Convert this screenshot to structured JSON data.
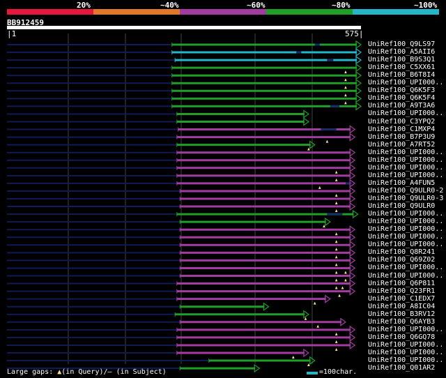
{
  "legend": [
    {
      "label": "20%",
      "color": "#e5183b"
    },
    {
      "label": "~40%",
      "color": "#e2782a"
    },
    {
      "label": "~60%",
      "color": "#a33ca1"
    },
    {
      "label": "~80%",
      "color": "#1f9f27"
    },
    {
      "label": "~100%",
      "color": "#26b6c9"
    }
  ],
  "query": {
    "id": "BB912459",
    "start": "1",
    "end": "575"
  },
  "footer": {
    "large_gaps": "Large gaps: ",
    "in_query": "(in Query)/",
    "dash": "—",
    "in_subject": " (in Subject)",
    "scale_label": "=100char."
  },
  "hits": [
    {
      "id": "UniRef100_Q9LS97",
      "color": "#1f9f27",
      "s": 268,
      "e": 575,
      "gaps": [
        [
          500,
          508
        ]
      ],
      "tri": []
    },
    {
      "id": "UniRef100_A5AII6",
      "color": "#26b6c9",
      "s": 268,
      "e": 575,
      "gaps": [
        [
          470,
          478
        ]
      ],
      "tri": []
    },
    {
      "id": "UniRef100_B9S3Q1",
      "color": "#26b6c9",
      "s": 273,
      "e": 575,
      "gaps": [
        [
          520,
          530
        ]
      ],
      "tri": []
    },
    {
      "id": "UniRef100_C5XX61",
      "color": "#1f9f27",
      "s": 268,
      "e": 575,
      "gaps": [],
      "tri": [
        550
      ]
    },
    {
      "id": "UniRef100_B6T8I4",
      "color": "#1f9f27",
      "s": 268,
      "e": 575,
      "gaps": [],
      "tri": [
        550
      ]
    },
    {
      "id": "UniRef100_UPI000..",
      "color": "#1f9f27",
      "s": 268,
      "e": 575,
      "gaps": [],
      "tri": [
        550
      ]
    },
    {
      "id": "UniRef100_Q6K5F3",
      "color": "#1f9f27",
      "s": 268,
      "e": 575,
      "gaps": [],
      "tri": [
        550
      ]
    },
    {
      "id": "UniRef100_Q6K5F4",
      "color": "#1f9f27",
      "s": 268,
      "e": 575,
      "gaps": [],
      "tri": [
        550
      ]
    },
    {
      "id": "UniRef100_A9T3A6",
      "color": "#1f9f27",
      "s": 268,
      "e": 575,
      "gaps": [
        [
          525,
          540
        ]
      ],
      "tri": []
    },
    {
      "id": "UniRef100_UPI000..",
      "color": "#1f9f27",
      "s": 276,
      "e": 490,
      "gaps": [],
      "tri": []
    },
    {
      "id": "UniRef100_C3YPQ2",
      "color": "#1f9f27",
      "s": 276,
      "e": 490,
      "gaps": [],
      "tri": []
    },
    {
      "id": "UniRef100_C1MXP4",
      "color": "#a33ca1",
      "s": 278,
      "e": 565,
      "gaps": [
        [
          510,
          535
        ]
      ],
      "tri": []
    },
    {
      "id": "UniRef100_B7P3U9",
      "color": "#a33ca1",
      "s": 276,
      "e": 565,
      "gaps": [],
      "tri": [
        520
      ]
    },
    {
      "id": "UniRef100_A7RT52",
      "color": "#1f9f27",
      "s": 276,
      "e": 500,
      "gaps": [],
      "tri": [
        490
      ]
    },
    {
      "id": "UniRef100_UPI000..",
      "color": "#a33ca1",
      "s": 276,
      "e": 565,
      "gaps": [],
      "tri": []
    },
    {
      "id": "UniRef100_UPI000..",
      "color": "#a33ca1",
      "s": 276,
      "e": 565,
      "gaps": [],
      "tri": []
    },
    {
      "id": "UniRef100_UPI000..",
      "color": "#a33ca1",
      "s": 276,
      "e": 565,
      "gaps": [],
      "tri": [
        535
      ]
    },
    {
      "id": "UniRef100_UPI000..",
      "color": "#a33ca1",
      "s": 276,
      "e": 565,
      "gaps": [],
      "tri": [
        535
      ]
    },
    {
      "id": "UniRef100_A4FUN5",
      "color": "#a33ca1",
      "s": 276,
      "e": 565,
      "gaps": [
        [
          550,
          560
        ]
      ],
      "tri": [
        508
      ]
    },
    {
      "id": "UniRef100_Q9ULR0-2",
      "color": "#a33ca1",
      "s": 281,
      "e": 565,
      "gaps": [],
      "tri": [
        535
      ]
    },
    {
      "id": "UniRef100_Q9ULR0-3",
      "color": "#a33ca1",
      "s": 281,
      "e": 565,
      "gaps": [],
      "tri": [
        535
      ]
    },
    {
      "id": "UniRef100_Q9ULR0",
      "color": "#a33ca1",
      "s": 281,
      "e": 565,
      "gaps": [],
      "tri": [
        535
      ]
    },
    {
      "id": "UniRef100_UPI000..",
      "color": "#1f9f27",
      "s": 276,
      "e": 570,
      "gaps": [
        [
          520,
          545
        ]
      ],
      "tri": []
    },
    {
      "id": "UniRef100_UPI000..",
      "color": "#1f9f27",
      "s": 281,
      "e": 525,
      "gaps": [],
      "tri": [
        515
      ]
    },
    {
      "id": "UniRef100_UPI000..",
      "color": "#a33ca1",
      "s": 281,
      "e": 565,
      "gaps": [],
      "tri": [
        535
      ]
    },
    {
      "id": "UniRef100_UPI000..",
      "color": "#a33ca1",
      "s": 281,
      "e": 565,
      "gaps": [],
      "tri": [
        535
      ]
    },
    {
      "id": "UniRef100_UPI000..",
      "color": "#a33ca1",
      "s": 281,
      "e": 565,
      "gaps": [],
      "tri": [
        535
      ]
    },
    {
      "id": "UniRef100_Q8R241",
      "color": "#a33ca1",
      "s": 281,
      "e": 565,
      "gaps": [],
      "tri": [
        535
      ]
    },
    {
      "id": "UniRef100_Q69Z02",
      "color": "#a33ca1",
      "s": 281,
      "e": 565,
      "gaps": [],
      "tri": [
        535
      ]
    },
    {
      "id": "UniRef100_UPI000..",
      "color": "#a33ca1",
      "s": 281,
      "e": 565,
      "gaps": [],
      "tri": [
        535,
        550
      ]
    },
    {
      "id": "UniRef100_UPI000..",
      "color": "#a33ca1",
      "s": 281,
      "e": 565,
      "gaps": [],
      "tri": [
        535,
        550
      ]
    },
    {
      "id": "UniRef100_Q6P811",
      "color": "#a33ca1",
      "s": 276,
      "e": 565,
      "gaps": [],
      "tri": [
        535,
        545
      ]
    },
    {
      "id": "UniRef100_Q23FR1",
      "color": "#a33ca1",
      "s": 276,
      "e": 565,
      "gaps": [],
      "tri": [
        540
      ]
    },
    {
      "id": "UniRef100_C1EDX7",
      "color": "#a33ca1",
      "s": 276,
      "e": 525,
      "gaps": [],
      "tri": [
        500
      ]
    },
    {
      "id": "UniRef100_A8IC04",
      "color": "#1f9f27",
      "s": 281,
      "e": 425,
      "gaps": [],
      "tri": []
    },
    {
      "id": "UniRef100_B3RV12",
      "color": "#1f9f27",
      "s": 273,
      "e": 490,
      "gaps": [],
      "tri": [
        485
      ]
    },
    {
      "id": "UniRef100_Q6AYB3",
      "color": "#a33ca1",
      "s": 281,
      "e": 550,
      "gaps": [],
      "tri": [
        505
      ]
    },
    {
      "id": "UniRef100_UPI000..",
      "color": "#a33ca1",
      "s": 276,
      "e": 565,
      "gaps": [],
      "tri": [
        535
      ]
    },
    {
      "id": "UniRef100_Q6GQ78",
      "color": "#a33ca1",
      "s": 276,
      "e": 565,
      "gaps": [],
      "tri": [
        535
      ]
    },
    {
      "id": "UniRef100_UPI000..",
      "color": "#a33ca1",
      "s": 276,
      "e": 565,
      "gaps": [],
      "tri": [
        535
      ]
    },
    {
      "id": "UniRef100_UPI000..",
      "color": "#a33ca1",
      "s": 276,
      "e": 490,
      "gaps": [],
      "tri": [
        465
      ]
    },
    {
      "id": "UniRef100_UPI000..",
      "color": "#1f9f27",
      "s": 328,
      "e": 500,
      "gaps": [],
      "tri": [
        490
      ]
    },
    {
      "id": "UniRef100_Q01AR2",
      "color": "#1f9f27",
      "s": 281,
      "e": 410,
      "gaps": [],
      "tri": []
    }
  ]
}
